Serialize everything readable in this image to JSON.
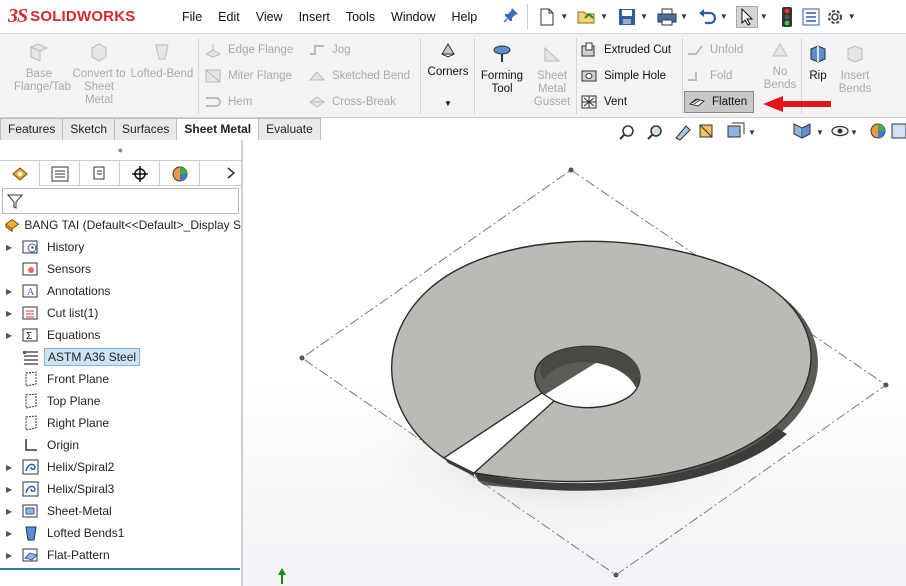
{
  "app": {
    "brand_prefix": "3S",
    "brand": "SOLIDWORKS"
  },
  "menu": [
    "File",
    "Edit",
    "View",
    "Insert",
    "Tools",
    "Window",
    "Help"
  ],
  "ribbon": {
    "base_flange": "Base Flange/Tab",
    "convert": "Convert to Sheet Metal",
    "lofted_bend": "Lofted-Bend",
    "edge_flange": "Edge Flange",
    "miter_flange": "Miter Flange",
    "hem": "Hem",
    "jog": "Jog",
    "sketched_bend": "Sketched Bend",
    "cross_break": "Cross-Break",
    "corners": "Corners",
    "forming_tool": "Forming Tool",
    "sheet_metal_gusset": "Sheet Metal Gusset",
    "extruded_cut": "Extruded Cut",
    "simple_hole": "Simple Hole",
    "vent": "Vent",
    "unfold": "Unfold",
    "fold": "Fold",
    "flatten": "Flatten",
    "no_bends": "No Bends",
    "rip": "Rip",
    "insert_bends": "Insert Bends"
  },
  "tabs": [
    "Features",
    "Sketch",
    "Surfaces",
    "Sheet Metal",
    "Evaluate"
  ],
  "active_tab": "Sheet Metal",
  "tree": {
    "root": "BANG TAI  (Default<<Default>_Display S",
    "items": [
      {
        "label": "History",
        "expandable": true,
        "icon": "history-icon"
      },
      {
        "label": "Sensors",
        "expandable": false,
        "icon": "sensors-icon"
      },
      {
        "label": "Annotations",
        "expandable": true,
        "icon": "annotations-icon"
      },
      {
        "label": "Cut list(1)",
        "expandable": true,
        "icon": "cut-list-icon"
      },
      {
        "label": "Equations",
        "expandable": true,
        "icon": "equations-icon"
      },
      {
        "label": "ASTM A36 Steel",
        "expandable": false,
        "icon": "material-icon",
        "selected": true
      },
      {
        "label": "Front Plane",
        "expandable": false,
        "icon": "plane-icon"
      },
      {
        "label": "Top Plane",
        "expandable": false,
        "icon": "plane-icon"
      },
      {
        "label": "Right Plane",
        "expandable": false,
        "icon": "plane-icon"
      },
      {
        "label": "Origin",
        "expandable": false,
        "icon": "origin-icon"
      },
      {
        "label": "Helix/Spiral2",
        "expandable": true,
        "icon": "helix-icon"
      },
      {
        "label": "Helix/Spiral3",
        "expandable": true,
        "icon": "helix-icon"
      },
      {
        "label": "Sheet-Metal",
        "expandable": true,
        "icon": "sheet-metal-icon"
      },
      {
        "label": "Lofted Bends1",
        "expandable": true,
        "icon": "lofted-bends-icon"
      },
      {
        "label": "Flat-Pattern",
        "expandable": true,
        "icon": "flat-pattern-icon"
      }
    ]
  },
  "colors": {
    "brand_red": "#d8262d",
    "part_gray": "#bcbab4",
    "selection_blue": "#cce4f7"
  }
}
